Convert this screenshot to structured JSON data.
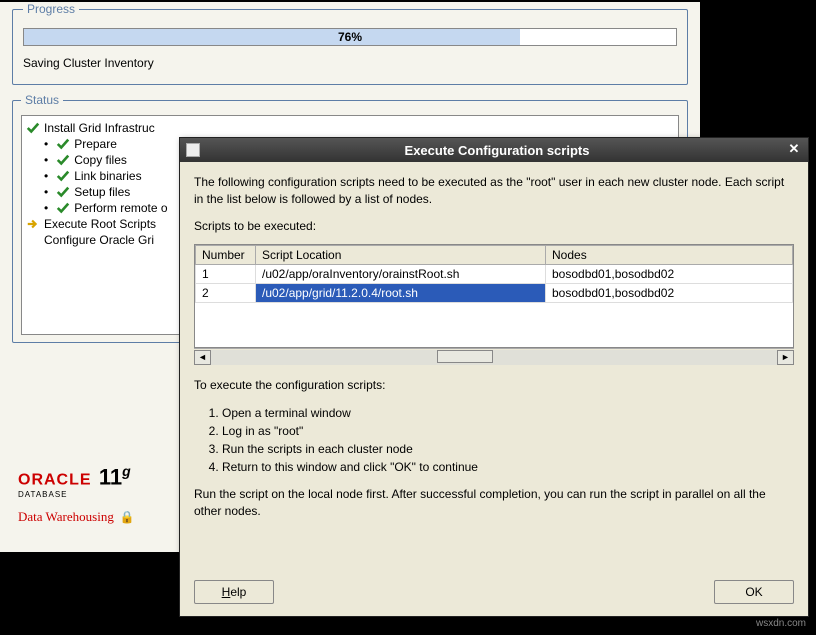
{
  "progress": {
    "legend": "Progress",
    "percent_label": "76%",
    "percent_value": 76,
    "status_text": "Saving Cluster Inventory"
  },
  "status": {
    "legend": "Status",
    "items": [
      {
        "icon": "check",
        "sub": false,
        "label": "Install Grid Infrastruc"
      },
      {
        "icon": "check",
        "sub": true,
        "label": "Prepare"
      },
      {
        "icon": "check",
        "sub": true,
        "label": "Copy files"
      },
      {
        "icon": "check",
        "sub": true,
        "label": "Link binaries"
      },
      {
        "icon": "check",
        "sub": true,
        "label": "Setup files"
      },
      {
        "icon": "check",
        "sub": true,
        "label": "Perform remote o"
      },
      {
        "icon": "arrow",
        "sub": false,
        "label": "Execute Root Scripts"
      },
      {
        "icon": "none",
        "sub": false,
        "label": "Configure Oracle Gri"
      }
    ]
  },
  "logo": {
    "brand": "ORACLE",
    "database": "DATABASE",
    "version": "11",
    "version_sup": "g",
    "tagline": "Data Warehousing"
  },
  "dialog": {
    "title": "Execute Configuration scripts",
    "intro": "The following configuration scripts need to be executed as the \"root\" user in each new cluster node. Each script in the list below is followed by a list of nodes.",
    "scripts_label": "Scripts to be executed:",
    "columns": {
      "number": "Number",
      "location": "Script Location",
      "nodes": "Nodes"
    },
    "rows": [
      {
        "number": "1",
        "location": "/u02/app/oraInventory/orainstRoot.sh",
        "nodes": "bosodbd01,bosodbd02",
        "selected": false
      },
      {
        "number": "2",
        "location": "/u02/app/grid/11.2.0.4/root.sh",
        "nodes": "bosodbd01,bosodbd02",
        "selected": true
      }
    ],
    "instructions_lead": "To execute the configuration scripts:",
    "steps": [
      "Open a terminal window",
      "Log in as \"root\"",
      "Run the scripts in each cluster node",
      "Return to this window and click \"OK\" to continue"
    ],
    "footnote": "Run the script on the local node first. After successful completion, you can run the script in parallel on all the other nodes.",
    "help_label": "Help",
    "ok_label": "OK"
  },
  "watermark": "wsxdn.com"
}
